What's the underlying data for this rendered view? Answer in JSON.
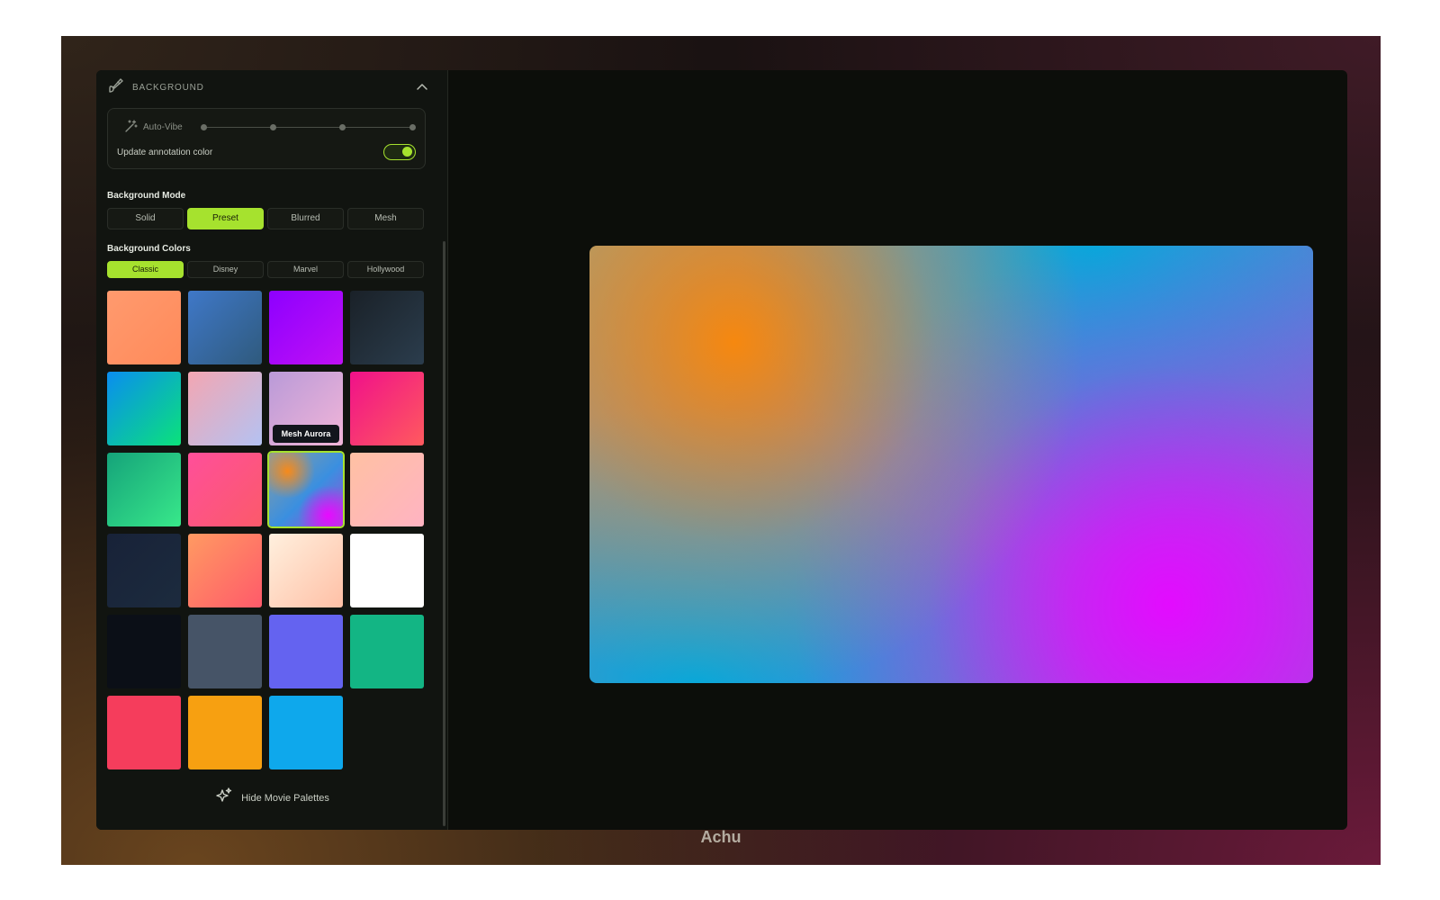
{
  "panel": {
    "title": "BACKGROUND",
    "autovibe_label": "Auto-Vibe",
    "annotation_label": "Update annotation color",
    "annotation_toggle_on": true,
    "mode_label": "Background Mode",
    "modes": [
      "Solid",
      "Preset",
      "Blurred",
      "Mesh"
    ],
    "active_mode": "Preset",
    "colors_label": "Background Colors",
    "palettes": [
      "Classic",
      "Disney",
      "Marvel",
      "Hollywood"
    ],
    "active_palette": "Classic",
    "tooltip": "Mesh Aurora",
    "hide_label": "Hide Movie Palettes"
  },
  "swatches": [
    {
      "fill": "linear-gradient(135deg,#ff9a6e,#ff8a5a)"
    },
    {
      "fill": "linear-gradient(135deg,#3f78c8,#2f5a7d)"
    },
    {
      "fill": "linear-gradient(135deg,#8d00ff,#c010f5)"
    },
    {
      "fill": "linear-gradient(135deg,#1a2128,#2b3d4d)"
    },
    {
      "fill": "linear-gradient(135deg,#0a8df0,#0be27a)"
    },
    {
      "fill": "linear-gradient(135deg,#f3a6b2,#b4c2f2)"
    },
    {
      "fill": "linear-gradient(135deg,#b99ad8,#f2b5d8)",
      "tooltip": true
    },
    {
      "fill": "linear-gradient(135deg,#f0108a,#ff5a5e)"
    },
    {
      "fill": "linear-gradient(135deg,#15a37a,#38e88a)"
    },
    {
      "fill": "linear-gradient(135deg,#ff4f9a,#fb5a6a)"
    },
    {
      "fill": "radial-gradient(circle at 25% 25%,#f78a1a 0%,rgba(247,138,26,0) 35%),radial-gradient(circle at 80% 85%,#e80aff 0%,rgba(232,10,255,0) 35%),linear-gradient(135deg,#8a9ea0,#3a8fe0 55%,#a04ad8)",
      "selected": true
    },
    {
      "fill": "linear-gradient(135deg,#ffc1a3,#ffb3c2)"
    },
    {
      "fill": "linear-gradient(135deg,#182238,#1c2b3e)"
    },
    {
      "fill": "linear-gradient(135deg,#ff9a62,#ff5a6a)"
    },
    {
      "fill": "linear-gradient(135deg,#fff0de,#ffc0a6)"
    },
    {
      "fill": "#ffffff"
    },
    {
      "fill": "#0b0f17"
    },
    {
      "fill": "#465467"
    },
    {
      "fill": "#6463f0"
    },
    {
      "fill": "#13b584"
    },
    {
      "fill": "#f53d5c"
    },
    {
      "fill": "#f7a011"
    },
    {
      "fill": "#0ea8ec"
    }
  ],
  "footer": {
    "name": "Achu"
  }
}
